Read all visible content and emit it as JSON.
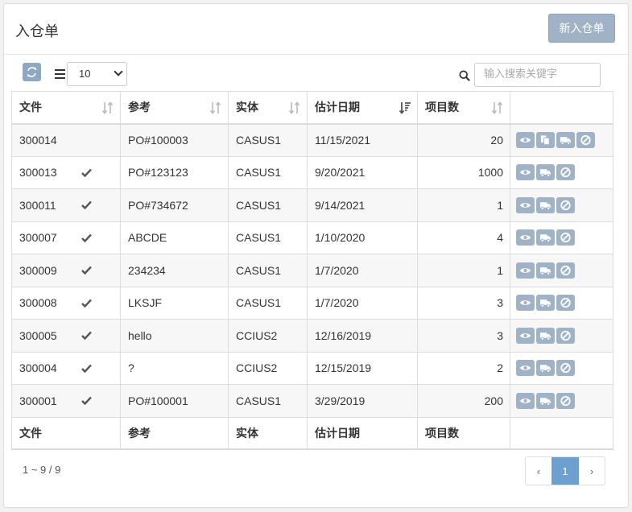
{
  "header": {
    "title": "入仓单",
    "new_button": "新入仓单"
  },
  "toolbar": {
    "page_size": "10",
    "search_placeholder": "输入搜索关键字"
  },
  "table": {
    "columns": [
      "文件",
      "参考",
      "实体",
      "估计日期",
      "项目数"
    ],
    "rows": [
      {
        "doc": "300014",
        "checked": false,
        "ref": "PO#100003",
        "entity": "CASUS1",
        "date": "11/15/2021",
        "count": "20",
        "actions": [
          "eye",
          "copy",
          "truck",
          "ban"
        ]
      },
      {
        "doc": "300013",
        "checked": true,
        "ref": "PO#123123",
        "entity": "CASUS1",
        "date": "9/20/2021",
        "count": "1000",
        "actions": [
          "eye",
          "truck",
          "ban"
        ]
      },
      {
        "doc": "300011",
        "checked": true,
        "ref": "PO#734672",
        "entity": "CASUS1",
        "date": "9/14/2021",
        "count": "1",
        "actions": [
          "eye",
          "truck",
          "ban"
        ]
      },
      {
        "doc": "300007",
        "checked": true,
        "ref": "ABCDE",
        "entity": "CASUS1",
        "date": "1/10/2020",
        "count": "4",
        "actions": [
          "eye",
          "truck",
          "ban"
        ]
      },
      {
        "doc": "300009",
        "checked": true,
        "ref": "234234",
        "entity": "CASUS1",
        "date": "1/7/2020",
        "count": "1",
        "actions": [
          "eye",
          "truck",
          "ban"
        ]
      },
      {
        "doc": "300008",
        "checked": true,
        "ref": "LKSJF",
        "entity": "CASUS1",
        "date": "1/7/2020",
        "count": "3",
        "actions": [
          "eye",
          "truck",
          "ban"
        ]
      },
      {
        "doc": "300005",
        "checked": true,
        "ref": "hello",
        "entity": "CCIUS2",
        "date": "12/16/2019",
        "count": "3",
        "actions": [
          "eye",
          "truck",
          "ban"
        ]
      },
      {
        "doc": "300004",
        "checked": true,
        "ref": "?",
        "entity": "CCIUS2",
        "date": "12/15/2019",
        "count": "2",
        "actions": [
          "eye",
          "truck",
          "ban"
        ]
      },
      {
        "doc": "300001",
        "checked": true,
        "ref": "PO#100001",
        "entity": "CASUS1",
        "date": "3/29/2019",
        "count": "200",
        "actions": [
          "eye",
          "truck",
          "ban"
        ]
      }
    ]
  },
  "footer": {
    "info": "1 ~ 9 / 9"
  },
  "pagination": {
    "prev": "‹",
    "current": "1",
    "next": "›"
  },
  "colors": {
    "button": "#9fb2c6",
    "active_page": "#6d9fd1",
    "stripe": "#f7f7f7"
  }
}
